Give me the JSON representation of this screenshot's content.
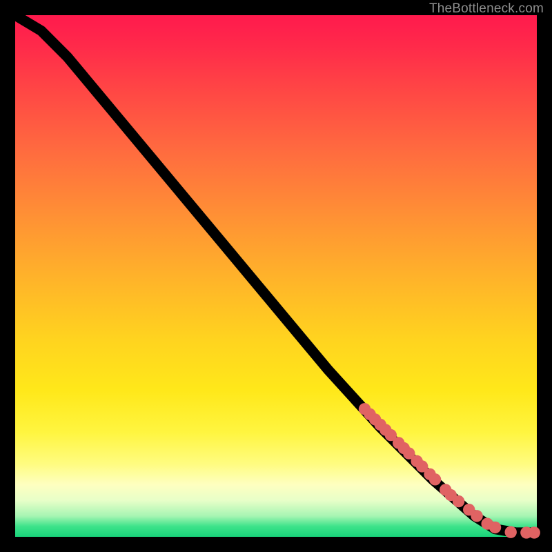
{
  "attribution": "TheBottleneck.com",
  "colors": {
    "dot": "#e06363",
    "curve": "#000000"
  },
  "chart_data": {
    "type": "line",
    "title": "",
    "xlabel": "",
    "ylabel": "",
    "xlim": [
      0,
      100
    ],
    "ylim": [
      0,
      100
    ],
    "background": "rainbow-vertical-gradient",
    "curve": [
      {
        "x": 0,
        "y": 100
      },
      {
        "x": 5,
        "y": 97
      },
      {
        "x": 10,
        "y": 92
      },
      {
        "x": 20,
        "y": 80
      },
      {
        "x": 30,
        "y": 68
      },
      {
        "x": 40,
        "y": 56
      },
      {
        "x": 50,
        "y": 44
      },
      {
        "x": 60,
        "y": 32
      },
      {
        "x": 70,
        "y": 21
      },
      {
        "x": 80,
        "y": 11
      },
      {
        "x": 88,
        "y": 4
      },
      {
        "x": 92,
        "y": 1.5
      },
      {
        "x": 96,
        "y": 0.8
      },
      {
        "x": 100,
        "y": 0.8
      }
    ],
    "points": [
      {
        "x": 67,
        "y": 24.5
      },
      {
        "x": 68,
        "y": 23.5
      },
      {
        "x": 69,
        "y": 22.5
      },
      {
        "x": 70,
        "y": 21.5
      },
      {
        "x": 71,
        "y": 20.5
      },
      {
        "x": 72,
        "y": 19.5
      },
      {
        "x": 73.5,
        "y": 18
      },
      {
        "x": 74.5,
        "y": 17
      },
      {
        "x": 75.5,
        "y": 16
      },
      {
        "x": 77,
        "y": 14.5
      },
      {
        "x": 78,
        "y": 13.5
      },
      {
        "x": 79.5,
        "y": 12
      },
      {
        "x": 80.5,
        "y": 11
      },
      {
        "x": 82.5,
        "y": 9
      },
      {
        "x": 83.5,
        "y": 8
      },
      {
        "x": 85,
        "y": 6.8
      },
      {
        "x": 87,
        "y": 5.2
      },
      {
        "x": 88.5,
        "y": 4
      },
      {
        "x": 90.5,
        "y": 2.5
      },
      {
        "x": 92,
        "y": 1.8
      },
      {
        "x": 95,
        "y": 0.9
      },
      {
        "x": 98,
        "y": 0.8
      },
      {
        "x": 99.5,
        "y": 0.8
      }
    ]
  }
}
